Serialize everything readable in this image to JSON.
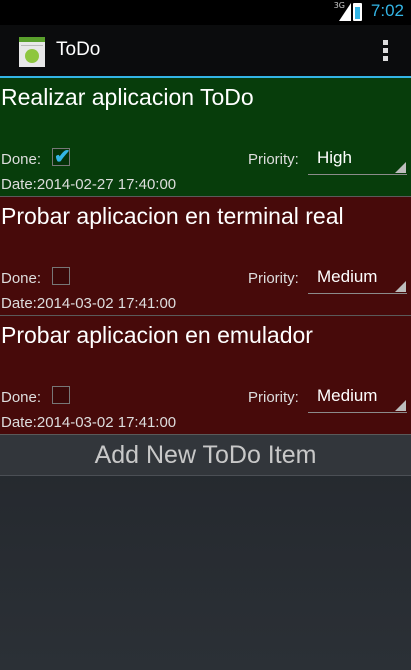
{
  "status_bar": {
    "network": "3G",
    "time": "7:02"
  },
  "action_bar": {
    "title": "ToDo"
  },
  "items": [
    {
      "title": "Realizar aplicacion ToDo",
      "done_label": "Done:",
      "done": true,
      "priority_label": "Priority:",
      "priority": "High",
      "date": "Date:2014-02-27 17:40:00",
      "color": "#073d0b"
    },
    {
      "title": "Probar aplicacion en terminal real",
      "done_label": "Done:",
      "done": false,
      "priority_label": "Priority:",
      "priority": "Medium",
      "date": "Date:2014-03-02 17:41:00",
      "color": "#470a0a"
    },
    {
      "title": "Probar aplicacion en emulador",
      "done_label": "Done:",
      "done": false,
      "priority_label": "Priority:",
      "priority": "Medium",
      "date": "Date:2014-03-02 17:41:00",
      "color": "#470a0a"
    }
  ],
  "add_button": "Add New ToDo Item",
  "colors": {
    "accent": "#33b5e5"
  }
}
